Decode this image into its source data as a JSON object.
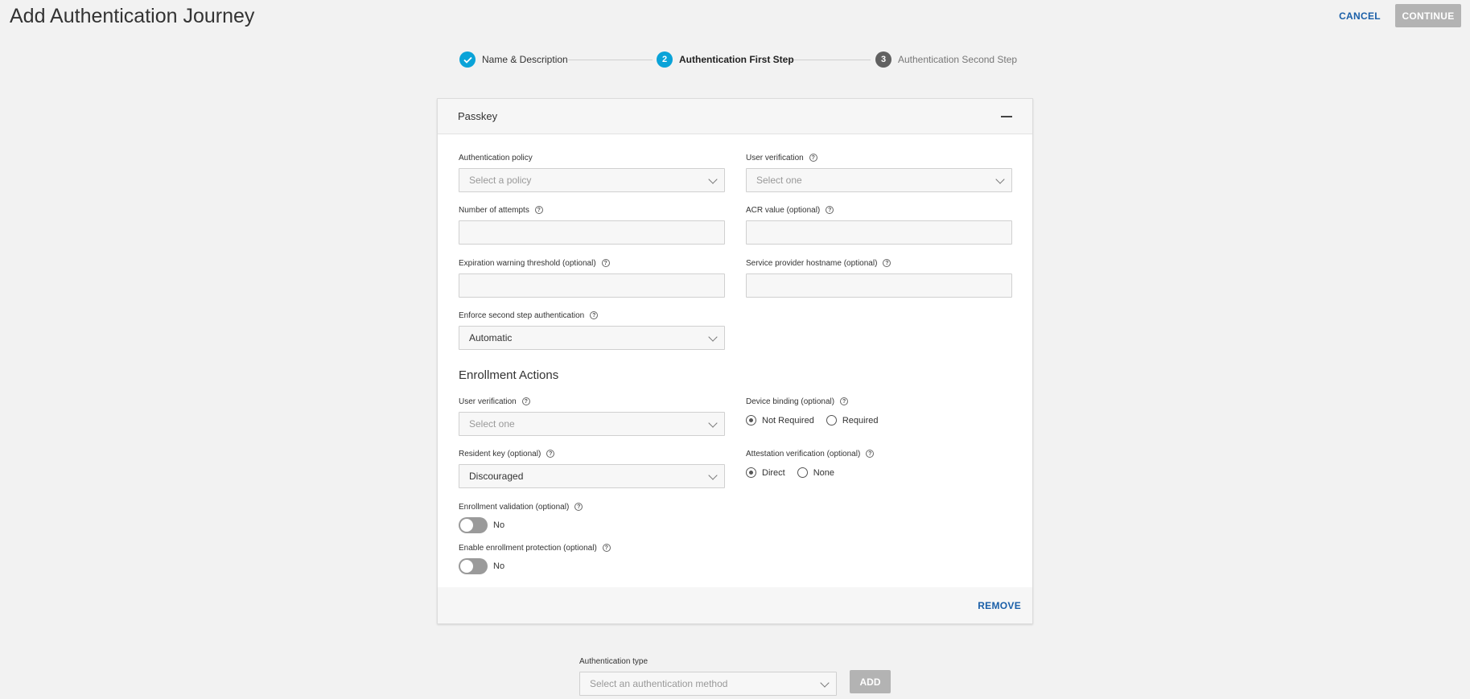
{
  "page": {
    "title": "Add Authentication Journey",
    "cancel_label": "CANCEL",
    "continue_label": "CONTINUE"
  },
  "stepper": {
    "steps": [
      {
        "number": "1",
        "label": "Name & Description",
        "state": "completed"
      },
      {
        "number": "2",
        "label": "Authentication First Step",
        "state": "active"
      },
      {
        "number": "3",
        "label": "Authentication Second Step",
        "state": "pending"
      }
    ]
  },
  "colors": {
    "accent": "#0aa3d8",
    "step_pending": "#616161",
    "link": "#1a5fa8",
    "disabled_button": "#b3b3b3"
  },
  "card": {
    "title": "Passkey",
    "remove_label": "REMOVE",
    "fields": {
      "authentication_policy": {
        "label": "Authentication policy",
        "placeholder": "Select a policy"
      },
      "user_verification": {
        "label": "User verification",
        "placeholder": "Select one"
      },
      "number_of_attempts": {
        "label": "Number of attempts",
        "value": ""
      },
      "acr_value": {
        "label": "ACR value (optional)",
        "value": ""
      },
      "expiration_warning": {
        "label": "Expiration warning threshold (optional)",
        "value": ""
      },
      "service_provider_hostname": {
        "label": "Service provider hostname (optional)",
        "value": ""
      },
      "enforce_second_step": {
        "label": "Enforce second step authentication",
        "value": "Automatic"
      }
    },
    "enrollment": {
      "title": "Enrollment Actions",
      "user_verification": {
        "label": "User verification",
        "placeholder": "Select one"
      },
      "device_binding": {
        "label": "Device binding (optional)",
        "options": [
          "Not Required",
          "Required"
        ],
        "selected": "Not Required"
      },
      "resident_key": {
        "label": "Resident key (optional)",
        "value": "Discouraged"
      },
      "attestation_verification": {
        "label": "Attestation verification (optional)",
        "options": [
          "Direct",
          "None"
        ],
        "selected": "Direct"
      },
      "enrollment_validation": {
        "label": "Enrollment validation (optional)",
        "state": "No"
      },
      "enrollment_protection": {
        "label": "Enable enrollment protection (optional)",
        "state": "No"
      }
    }
  },
  "authentication_type": {
    "label": "Authentication type",
    "placeholder": "Select an authentication method",
    "add_label": "ADD"
  },
  "icons": {
    "check": "check-icon",
    "help": "help-circle-icon",
    "chevron": "chevron-down-icon",
    "collapse": "minus-icon"
  }
}
